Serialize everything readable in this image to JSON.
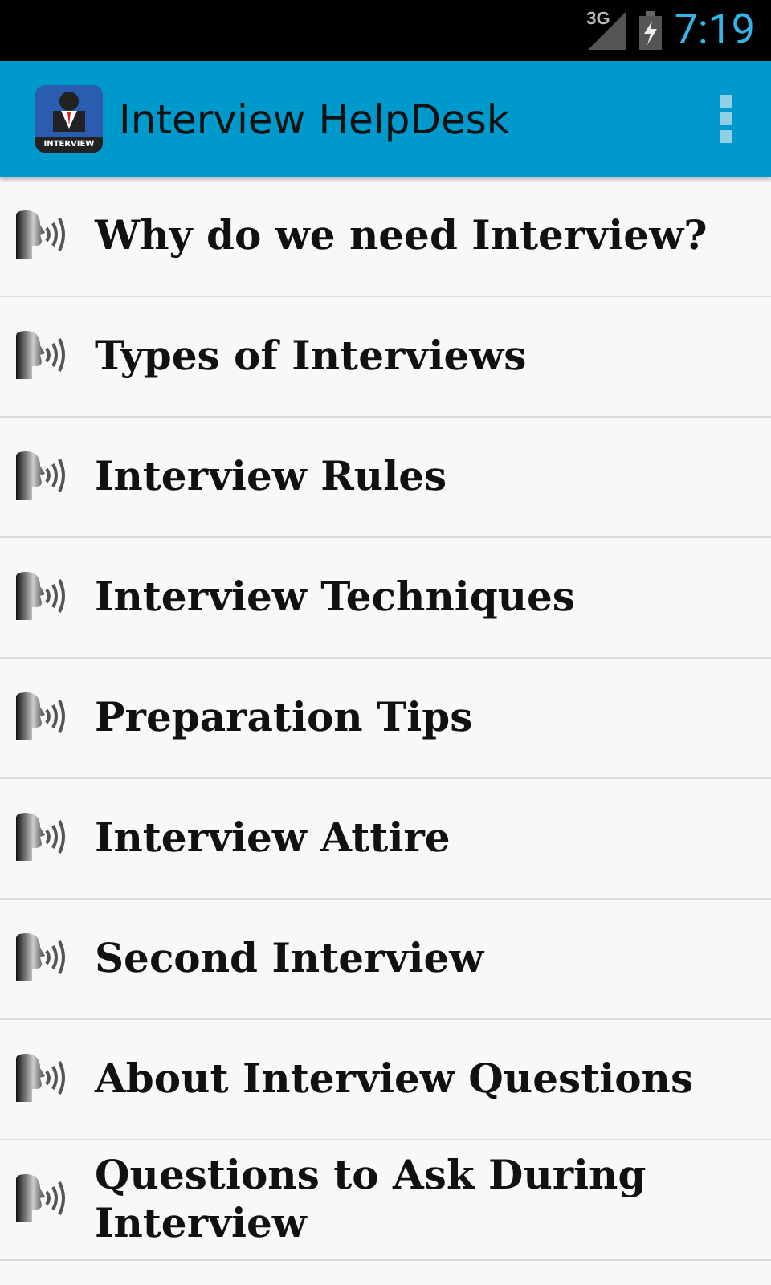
{
  "status_bar": {
    "network": "3G",
    "time": "7:19"
  },
  "app_bar": {
    "icon_label": "INTERVIEW",
    "title": "Interview HelpDesk"
  },
  "topics": [
    {
      "label": "Why do we need Interview?"
    },
    {
      "label": "Types of Interviews"
    },
    {
      "label": "Interview Rules"
    },
    {
      "label": "Interview Techniques"
    },
    {
      "label": "Preparation Tips"
    },
    {
      "label": "Interview Attire"
    },
    {
      "label": "Second Interview"
    },
    {
      "label": "About Interview Questions"
    },
    {
      "label": "Questions to Ask During Interview"
    }
  ]
}
